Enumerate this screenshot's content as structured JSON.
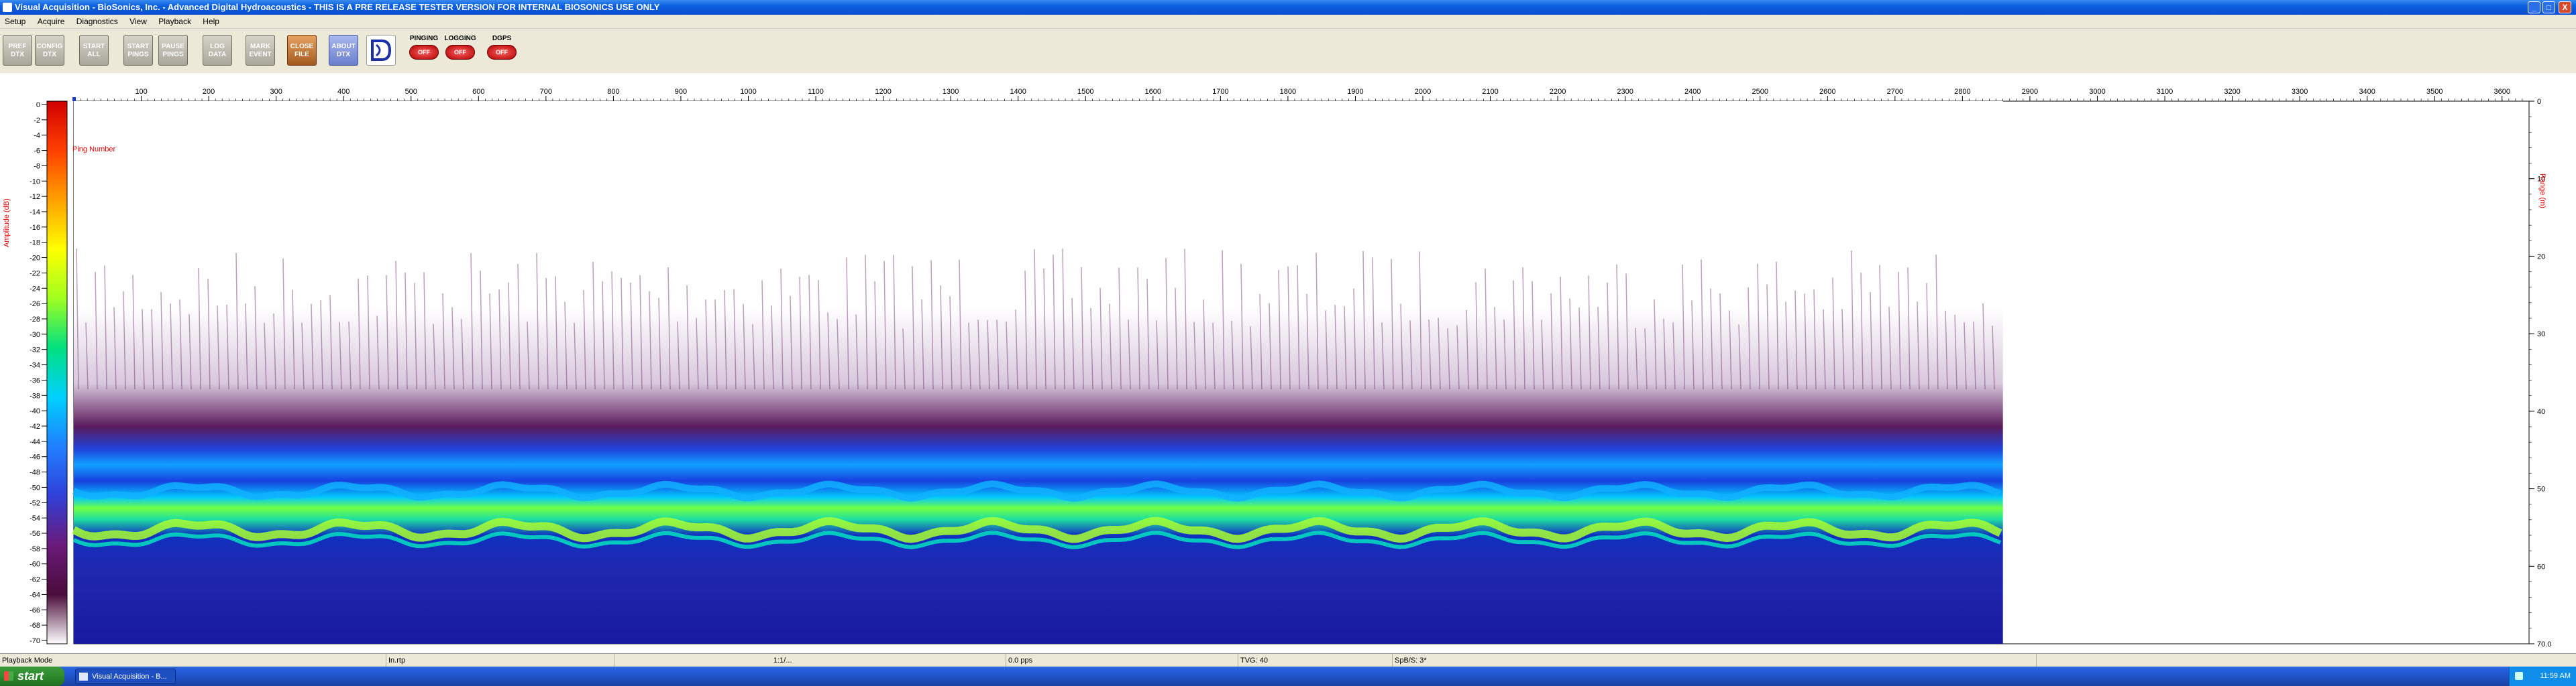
{
  "window": {
    "title": "Visual Acquisition  -  BioSonics, Inc.  -  Advanced Digital Hydroacoustics  -  THIS IS A PRE RELEASE TESTER VERSION FOR INTERNAL BIOSONICS USE ONLY",
    "min_label": "_",
    "max_label": "□",
    "close_label": "X"
  },
  "menu": [
    "Setup",
    "Acquire",
    "Diagnostics",
    "View",
    "Playback",
    "Help"
  ],
  "toolbar": {
    "buttons": [
      {
        "label": "PREF DTX"
      },
      {
        "label": "CONFIG DTX"
      },
      {
        "label": "START ALL"
      },
      {
        "label": "START PINGS"
      },
      {
        "label": "PAUSE PINGS"
      },
      {
        "label": "LOG DATA"
      },
      {
        "label": "MARK EVENT"
      },
      {
        "label": "CLOSE FILE"
      },
      {
        "label": "ABOUT DTX"
      }
    ],
    "status": [
      {
        "label": "PINGING",
        "state": "OFF"
      },
      {
        "label": "LOGGING",
        "state": "OFF"
      },
      {
        "label": "DGPS",
        "state": "OFF"
      }
    ],
    "colors": {
      "orange": "#c57a3a",
      "blue": "#8a9ce0",
      "status_off": "#cc0000"
    }
  },
  "echogram": {
    "ping_axis_title": "Ping Number",
    "amplitude_axis_title": "Amplitude (dB)",
    "depth_axis_title": "Range (m)",
    "ping_ticks": [
      100,
      200,
      300,
      400,
      500,
      600,
      700,
      800,
      900,
      1000,
      1100,
      1200,
      1300,
      1400,
      1500,
      1600,
      1700,
      1800,
      1900,
      2000,
      2100,
      2200,
      2300,
      2400,
      2500,
      2600,
      2700,
      2800,
      2900,
      3000,
      3100,
      3200,
      3300,
      3400,
      3500,
      3600
    ],
    "amplitude_ticks": [
      0,
      -2,
      -4,
      -6,
      -8,
      -10,
      -12,
      -14,
      -16,
      -18,
      -20,
      -22,
      -24,
      -26,
      -28,
      -30,
      -32,
      -34,
      -36,
      -38,
      -40,
      -42,
      -44,
      -46,
      -48,
      -50,
      -52,
      -54,
      -56,
      -58,
      -60,
      -62,
      -64,
      -66,
      -68,
      -70
    ],
    "depth_ticks": [
      "0",
      "10",
      "20",
      "30",
      "40",
      "50",
      "60",
      "70.0"
    ],
    "ping_range": [
      0,
      3640
    ],
    "depth_range": [
      0,
      70
    ],
    "data_ping_end": 2860,
    "colormap": [
      "#ffffff",
      "#4a0d3a",
      "#6a1a7a",
      "#3040d8",
      "#2080ff",
      "#00d0ff",
      "#00e080",
      "#a0ff20",
      "#ffff00",
      "#ffa000",
      "#ff4000",
      "#d00000"
    ],
    "amplitude_labels": [
      "0",
      "-2",
      "-4",
      "-6",
      "-8",
      "-10",
      "-12",
      "-14",
      "-16",
      "-18",
      "-20",
      "-22",
      "-24",
      "-26",
      "-28",
      "-30",
      "-32",
      "-34",
      "-36",
      "-38",
      "-40",
      "-42",
      "-44",
      "-46",
      "-48",
      "-50",
      "-52",
      "-54",
      "-56",
      "-58",
      "-60",
      "-62",
      "-64",
      "-66",
      "-68",
      "-70"
    ]
  },
  "statusbar": {
    "mode": "Playback Mode",
    "file": "In.rtp",
    "time": "1:1/...",
    "rate": "0.0 pps",
    "tvg": "TVG: 40",
    "spl": "SpB/S: 3*"
  },
  "taskbar": {
    "start_label": "start",
    "task_label": "Visual Acquisition - B...",
    "clock": "11:59 AM"
  }
}
